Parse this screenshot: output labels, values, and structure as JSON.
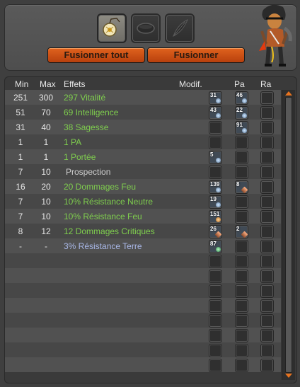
{
  "buttons": {
    "merge_all": "Fusionner tout",
    "merge": "Fusionner"
  },
  "table": {
    "headers": {
      "min": "Min",
      "max": "Max",
      "effects": "Effets",
      "modif": "Modif.",
      "pa": "Pa",
      "ra": "Ra"
    },
    "rows": [
      {
        "min": "251",
        "max": "300",
        "effect": "297 Vitalité",
        "style": "green",
        "modif": {
          "n": "31",
          "kind": "blue"
        },
        "pa": {
          "n": "46",
          "kind": "blue"
        }
      },
      {
        "min": "51",
        "max": "70",
        "effect": "69 Intelligence",
        "style": "green",
        "modif": {
          "n": "43",
          "kind": "blue"
        },
        "pa": {
          "n": "22",
          "kind": "blue"
        }
      },
      {
        "min": "31",
        "max": "40",
        "effect": "38 Sagesse",
        "style": "green",
        "modif": null,
        "pa": {
          "n": "91",
          "kind": "blue"
        }
      },
      {
        "min": "1",
        "max": "1",
        "effect": "1 PA",
        "style": "green",
        "modif": null,
        "pa": null
      },
      {
        "min": "1",
        "max": "1",
        "effect": "1 Portée",
        "style": "green",
        "modif": {
          "n": "5",
          "kind": "blue"
        },
        "pa": null
      },
      {
        "min": "7",
        "max": "10",
        "effect": "Prospection",
        "style": "neutral",
        "modif": null,
        "pa": null
      },
      {
        "min": "16",
        "max": "20",
        "effect": "20 Dommages Feu",
        "style": "green",
        "modif": {
          "n": "139",
          "kind": "blue"
        },
        "pa": {
          "n": "8",
          "kind": "pa"
        }
      },
      {
        "min": "7",
        "max": "10",
        "effect": "10% Résistance Neutre",
        "style": "green",
        "modif": {
          "n": "19",
          "kind": "blue"
        },
        "pa": null
      },
      {
        "min": "7",
        "max": "10",
        "effect": "10% Résistance Feu",
        "style": "green",
        "modif": {
          "n": "151",
          "kind": "orange"
        },
        "pa": null
      },
      {
        "min": "8",
        "max": "12",
        "effect": "12 Dommages Critiques",
        "style": "green",
        "modif": {
          "n": "26",
          "kind": "pa"
        },
        "pa": {
          "n": "2",
          "kind": "pa"
        }
      },
      {
        "min": "-",
        "max": "-",
        "effect": "3% Résistance Terre",
        "style": "blue",
        "modif": {
          "n": "87",
          "kind": "green"
        },
        "pa": null
      },
      {
        "min": "",
        "max": "",
        "effect": "",
        "style": "green",
        "modif": null,
        "pa": null
      },
      {
        "min": "",
        "max": "",
        "effect": "",
        "style": "green",
        "modif": null,
        "pa": null
      },
      {
        "min": "",
        "max": "",
        "effect": "",
        "style": "green",
        "modif": null,
        "pa": null
      },
      {
        "min": "",
        "max": "",
        "effect": "",
        "style": "green",
        "modif": null,
        "pa": null
      },
      {
        "min": "",
        "max": "",
        "effect": "",
        "style": "green",
        "modif": null,
        "pa": null
      },
      {
        "min": "",
        "max": "",
        "effect": "",
        "style": "green",
        "modif": null,
        "pa": null
      },
      {
        "min": "",
        "max": "",
        "effect": "",
        "style": "green",
        "modif": null,
        "pa": null
      },
      {
        "min": "",
        "max": "",
        "effect": "",
        "style": "green",
        "modif": null,
        "pa": null
      }
    ]
  },
  "colors": {
    "accent": "#e0631e",
    "effect_green": "#7fce4e",
    "effect_blue": "#a9b8e8"
  },
  "icons": [
    "amulet-icon",
    "belt-icon",
    "feather-icon",
    "character-avatar"
  ]
}
